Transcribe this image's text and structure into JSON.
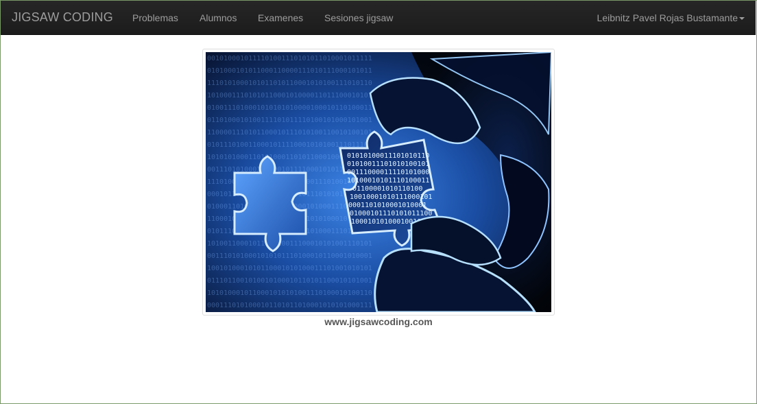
{
  "navbar": {
    "brand": "JIGSAW CODING",
    "items": [
      {
        "label": "Problemas"
      },
      {
        "label": "Alumnos"
      },
      {
        "label": "Examenes"
      },
      {
        "label": "Sesiones jigsaw"
      }
    ],
    "user_name": "Leibnitz Pavel Rojas Bustamante"
  },
  "main": {
    "image_icon": "jigsaw-binary-hand-image",
    "caption": "www.jigsawcoding.com"
  },
  "colors": {
    "navbar_bg": "#222222",
    "nav_text": "#9d9d9d",
    "image_accent": "#2a6fd6",
    "caption_text": "#555555"
  }
}
